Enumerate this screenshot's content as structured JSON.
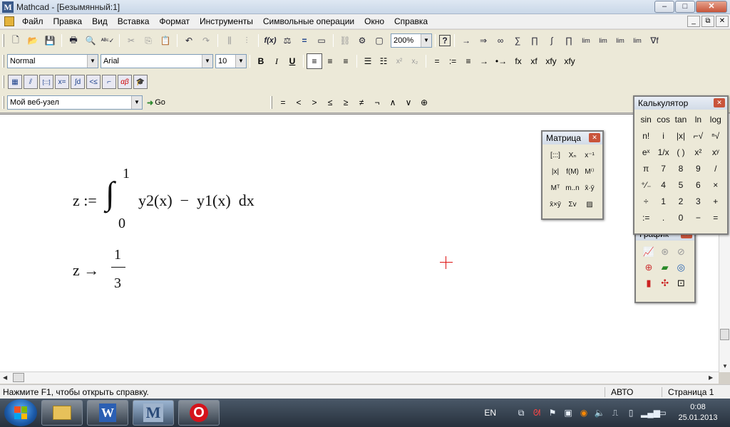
{
  "window": {
    "title": "Mathcad - [Безымянный:1]",
    "controls": {
      "minimize": "–",
      "maximize": "□",
      "close": "✕"
    },
    "mdi_controls": {
      "minimize": "_",
      "restore": "⧉",
      "close": "✕"
    }
  },
  "menu": [
    "Файл",
    "Правка",
    "Вид",
    "Вставка",
    "Формат",
    "Инструменты",
    "Символьные операции",
    "Окно",
    "Справка"
  ],
  "toolbar_standard": {
    "icons": [
      "new-icon",
      "open-icon",
      "save-icon",
      "print-icon",
      "preview-icon",
      "spellcheck-icon",
      "cut-icon",
      "copy-icon",
      "paste-icon",
      "undo-icon",
      "redo-icon",
      "align-across-icon",
      "align-down-icon",
      "insert-function-icon",
      "insert-unit-icon",
      "calculate-icon",
      "insert-graph-icon",
      "insert-hyperlink-icon",
      "component-icon"
    ],
    "zoom": "200%",
    "help": "?"
  },
  "toolbar_symbolic": [
    "→",
    "⇒",
    "∞",
    "∑",
    "∏",
    "∫",
    "∏",
    "lim",
    "lim",
    "lim",
    "lim",
    "∇f"
  ],
  "toolbar_format": {
    "style": "Normal",
    "font": "Arial",
    "size": "10",
    "bold": "B",
    "italic": "I",
    "underline": "U",
    "sub": "x²",
    "super": "x₂"
  },
  "toolbar_eval": [
    "=",
    ":=",
    "≡",
    "→",
    "•→",
    "fx",
    "xf",
    "xfy",
    "xfy"
  ],
  "toolbar_math": [
    "calculator-icon",
    "graph-icon",
    "matrix-icon",
    "eval-icon",
    "calculus-icon",
    "boolean-icon",
    "programming-icon",
    "greek-icon",
    "symbolic-icon"
  ],
  "toolbar_math_labels": [
    "▦",
    "⫽",
    "[:::]",
    "x=",
    "∫d",
    "<≤",
    "⌐",
    "αβ",
    "🎓"
  ],
  "toolbar_web": {
    "address": "Мой веб-узел",
    "go": "Go"
  },
  "toolbar_boolean": [
    "=",
    "<",
    ">",
    "≤",
    "≥",
    "≠",
    "¬",
    "∧",
    "∨",
    "⊕"
  ],
  "worksheet": {
    "line1": {
      "lhs": "z :=",
      "integral": "∫",
      "upper": "1",
      "lower": "0",
      "body": "y2(x)  −  y1(x)  dx"
    },
    "line2": {
      "lhs": "z →",
      "num": "1",
      "den": "3"
    }
  },
  "palettes": {
    "matrix": {
      "title": "Матрица",
      "cells": [
        "[:::]",
        "Xₙ",
        "x⁻¹",
        "|x|",
        "f(M)",
        "M⁽⁾",
        "Mᵀ",
        "m..n",
        "x̄·ȳ",
        "x̄×ȳ",
        "Σv",
        "▨"
      ]
    },
    "calculator": {
      "title": "Калькулятор",
      "cells": [
        "sin",
        "cos",
        "tan",
        "ln",
        "log",
        "n!",
        "i",
        "|x|",
        "⌐√",
        "ⁿ√",
        "eˣ",
        "1/x",
        "( )",
        "x²",
        "xʸ",
        "π",
        "7",
        "8",
        "9",
        "/",
        "⁺⁄₋",
        "4",
        "5",
        "6",
        "×",
        "÷",
        "1",
        "2",
        "3",
        "+",
        ":=",
        ".",
        "0",
        "−",
        "="
      ]
    },
    "graph": {
      "title": "График",
      "cells": [
        "📈",
        "⊛",
        "⊘",
        "⊕",
        "▰",
        "◎",
        "▮",
        "✣",
        "⊡"
      ]
    }
  },
  "status": {
    "help": "Нажмите F1, чтобы открыть справку.",
    "mode": "АВТО",
    "page": "Страница 1"
  },
  "taskbar": {
    "language": "EN",
    "time": "0:08",
    "date": "25.01.2013",
    "apps": [
      "explorer",
      "word",
      "mathcad",
      "opera"
    ],
    "word_label": "W",
    "mathcad_label": "M",
    "opera_label": "O"
  },
  "colors": {
    "crosshair": "#dd1111",
    "taskbar": "#2f3a47",
    "toolbar_bg": "#ece9d8"
  }
}
